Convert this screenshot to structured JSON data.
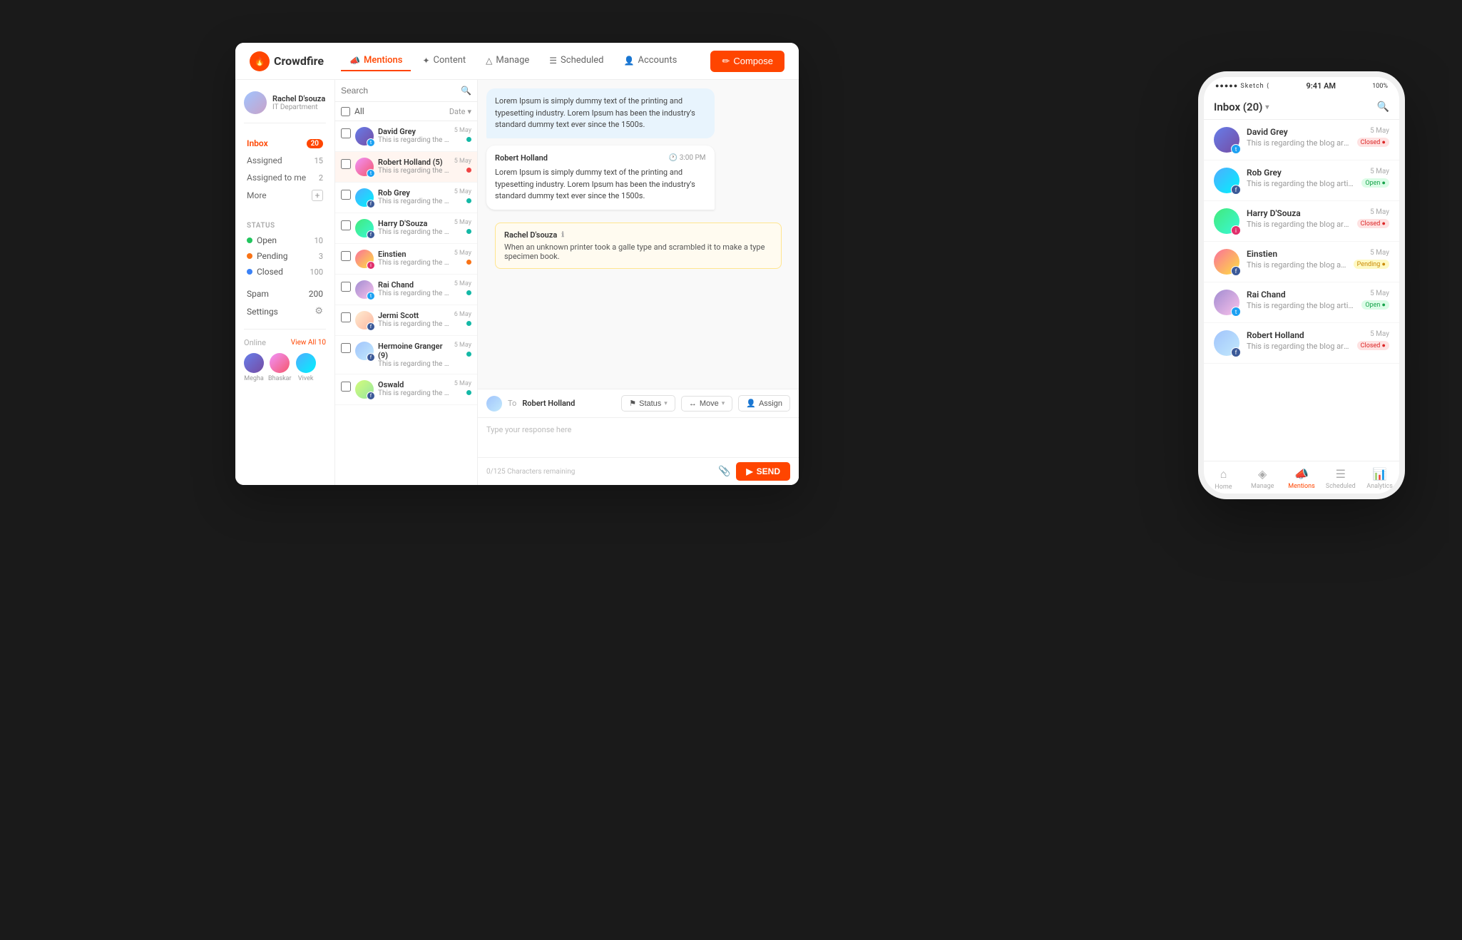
{
  "app": {
    "logo": "Crowdfire",
    "nav": {
      "items": [
        {
          "label": "Mentions",
          "active": true,
          "icon": "📣"
        },
        {
          "label": "Content",
          "active": false,
          "icon": "✦"
        },
        {
          "label": "Manage",
          "active": false,
          "icon": "△"
        },
        {
          "label": "Scheduled",
          "active": false,
          "icon": "☰"
        },
        {
          "label": "Accounts",
          "active": false,
          "icon": "👤"
        }
      ],
      "compose": "Compose"
    },
    "sidebar": {
      "user": {
        "name": "Rachel D'souza",
        "dept": "IT Department"
      },
      "nav": [
        {
          "label": "Inbox",
          "count": "20",
          "active": true
        },
        {
          "label": "Assigned",
          "count": "15",
          "active": false
        },
        {
          "label": "Assigned to me",
          "count": "2",
          "active": false
        },
        {
          "label": "More",
          "count": "",
          "active": false
        }
      ],
      "status": {
        "title": "Status",
        "items": [
          {
            "label": "Open",
            "count": "10",
            "color": "green"
          },
          {
            "label": "Pending",
            "count": "3",
            "color": "orange"
          },
          {
            "label": "Closed",
            "count": "100",
            "color": "blue"
          }
        ]
      },
      "spam": {
        "label": "Spam",
        "count": "200"
      },
      "settings": {
        "label": "Settings"
      },
      "online": {
        "title": "Online",
        "viewAll": "View All 10",
        "users": [
          {
            "name": "Megha"
          },
          {
            "name": "Bhaskar"
          },
          {
            "name": "Vivek"
          }
        ]
      }
    },
    "messageList": {
      "searchPlaceholder": "Search",
      "allLabel": "All",
      "dateSort": "Date",
      "messages": [
        {
          "name": "David Grey",
          "text": "This is regarding the blog article published on the fest...",
          "date": "5 May",
          "social": "tw",
          "dotColor": "teal"
        },
        {
          "name": "Robert Holland (5)",
          "text": "This is regarding the blog article published on the fest...",
          "date": "5 May",
          "social": "tw",
          "dotColor": "red"
        },
        {
          "name": "Rob Grey",
          "text": "This is regarding the blog article published on the fest...",
          "date": "5 May",
          "social": "fb",
          "dotColor": "teal"
        },
        {
          "name": "Harry D'Souza",
          "text": "This is regarding the blog article published on the fest...",
          "date": "5 May",
          "social": "fb",
          "dotColor": "teal"
        },
        {
          "name": "Einstien",
          "text": "This is regarding the blog article published on the fest...",
          "date": "5 May",
          "social": "ig",
          "dotColor": "orange"
        },
        {
          "name": "Rai Chand",
          "text": "This is regarding the blog article published on the fest...",
          "date": "5 May",
          "social": "tw",
          "dotColor": "teal"
        },
        {
          "name": "Jermi Scott",
          "text": "This is regarding the blog article published on the fest...",
          "date": "6 May",
          "social": "fb",
          "dotColor": "teal"
        },
        {
          "name": "Hermoine Granger (9)",
          "text": "This is regarding the blog article published on the fest...",
          "date": "5 May",
          "social": "fb",
          "dotColor": "teal"
        },
        {
          "name": "Oswald",
          "text": "This is regarding the blog",
          "date": "5 May",
          "social": "fb",
          "dotColor": "teal"
        }
      ]
    },
    "chat": {
      "bubbles": [
        {
          "type": "incoming",
          "text": "Lorem Ipsum is simply dummy text of the printing and typesetting industry. Lorem Ipsum has been the industry's standard dummy text ever since the 1500s."
        },
        {
          "type": "outgoing",
          "name": "Robert Holland",
          "time": "3:00 PM",
          "text": "Lorem Ipsum is simply dummy text of the printing and typesetting industry. Lorem Ipsum has been the industry's standard dummy text ever since the 1500s."
        }
      ],
      "note": {
        "author": "Rachel D'souza",
        "text": "When an unknown printer took a galle type and scrambled it to make a type specimen book."
      },
      "reply": {
        "toLabel": "To",
        "toName": "Robert Holland",
        "statusLabel": "Status",
        "moveLabel": "Move",
        "assignLabel": "Assign",
        "inputPlaceholder": "Type your response here",
        "charCount": "0/125 Characters remaining",
        "sendLabel": "SEND"
      }
    }
  },
  "mobile": {
    "statusBar": {
      "signal": "●●●●● Sketch ⟨",
      "time": "9:41 AM",
      "battery": "100%"
    },
    "inboxTitle": "Inbox (20)",
    "searchIcon": "🔍",
    "messages": [
      {
        "name": "David Grey",
        "text": "This is regarding the blog article published on the festive...",
        "date": "5 May",
        "statusBadge": "",
        "social": "tw",
        "dotColor": "closed"
      },
      {
        "name": "Rob Grey",
        "text": "This is regarding the blog article published on the festive...",
        "date": "5 May",
        "statusBadge": "Open",
        "social": "fb",
        "dotColor": "open"
      },
      {
        "name": "Harry D'Souza",
        "text": "This is regarding the blog article published on the festive...",
        "date": "5 May",
        "statusBadge": "Closed",
        "social": "ig",
        "dotColor": "closed"
      },
      {
        "name": "Einstien",
        "text": "This is regarding the blog article published on the festive...",
        "date": "5 May",
        "statusBadge": "Pending",
        "social": "fb",
        "dotColor": "pending"
      },
      {
        "name": "Rai Chand",
        "text": "This is regarding the blog article published on the festive...",
        "date": "5 May",
        "statusBadge": "Open",
        "social": "tw",
        "dotColor": "open"
      },
      {
        "name": "Robert Holland",
        "text": "This is regarding the blog article published on the festive...",
        "date": "5 May",
        "statusBadge": "Closed",
        "social": "fb",
        "dotColor": "closed"
      }
    ],
    "bottomNav": [
      {
        "label": "Home",
        "icon": "⌂",
        "active": false
      },
      {
        "label": "Manage",
        "icon": "◈",
        "active": false
      },
      {
        "label": "Mentions",
        "icon": "📣",
        "active": true
      },
      {
        "label": "Scheduled",
        "icon": "☰",
        "active": false
      },
      {
        "label": "Analytics",
        "icon": "📊",
        "active": false
      }
    ]
  }
}
